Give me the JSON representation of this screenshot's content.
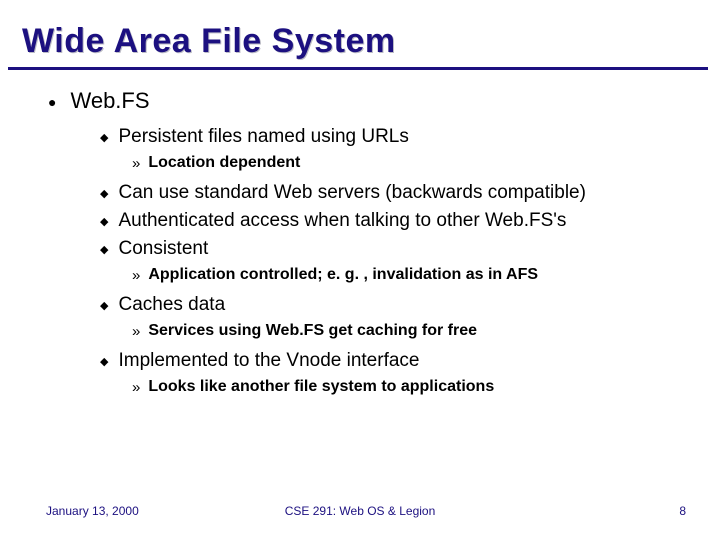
{
  "title": "Wide Area File System",
  "main_item": "Web.FS",
  "subitems": [
    {
      "text": "Persistent files named using URLs",
      "notes": [
        "Location dependent"
      ]
    },
    {
      "text": "Can use standard Web servers (backwards compatible)",
      "notes": []
    },
    {
      "text": "Authenticated access when talking to other Web.FS's",
      "notes": []
    },
    {
      "text": "Consistent",
      "notes": [
        "Application controlled; e. g. , invalidation as in AFS"
      ]
    },
    {
      "text": "Caches data",
      "notes": [
        "Services using Web.FS get caching for free"
      ]
    },
    {
      "text": "Implemented to the Vnode interface",
      "notes": [
        "Looks like another file system to applications"
      ]
    }
  ],
  "footer": {
    "date": "January 13, 2000",
    "course": "CSE 291: Web OS & Legion",
    "page": "8"
  }
}
